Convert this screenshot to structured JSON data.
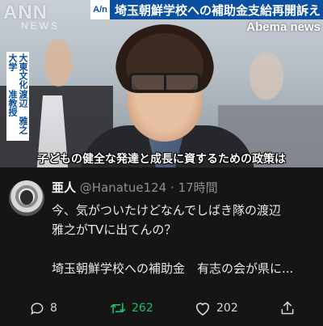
{
  "video": {
    "logo": "ANN",
    "logo_sub": "NEWS",
    "badge": "A/n",
    "headline": "埼玉朝鮮学校への補助金支給再開訴え",
    "channel": "Abema news",
    "affiliation_line1": "大東文化大学",
    "affiliation_line2": "渡辺　雅之准教授",
    "subtitle": "子どもの健全な発達と成長に資するための政策は"
  },
  "tweet": {
    "display_name": "亜人",
    "handle": "@Hanatue124",
    "separator": "·",
    "time": "17時間",
    "text_line1": "今、気がついたけどなんでしばき隊の渡辺",
    "text_line2": "雅之がTVに出てんの？",
    "text_line3": "埼玉朝鮮学校への補助金　有志の会が県に..."
  },
  "actions": {
    "reply_icon": "reply-icon",
    "reply_count": "8",
    "retweet_icon": "retweet-icon",
    "retweet_count": "262",
    "retweet_color": "#19bf6b",
    "like_icon": "heart-icon",
    "like_count": "202",
    "share_icon": "share-icon"
  },
  "colors": {
    "headline_bar": "#0a4fa0",
    "background": "#151515"
  }
}
